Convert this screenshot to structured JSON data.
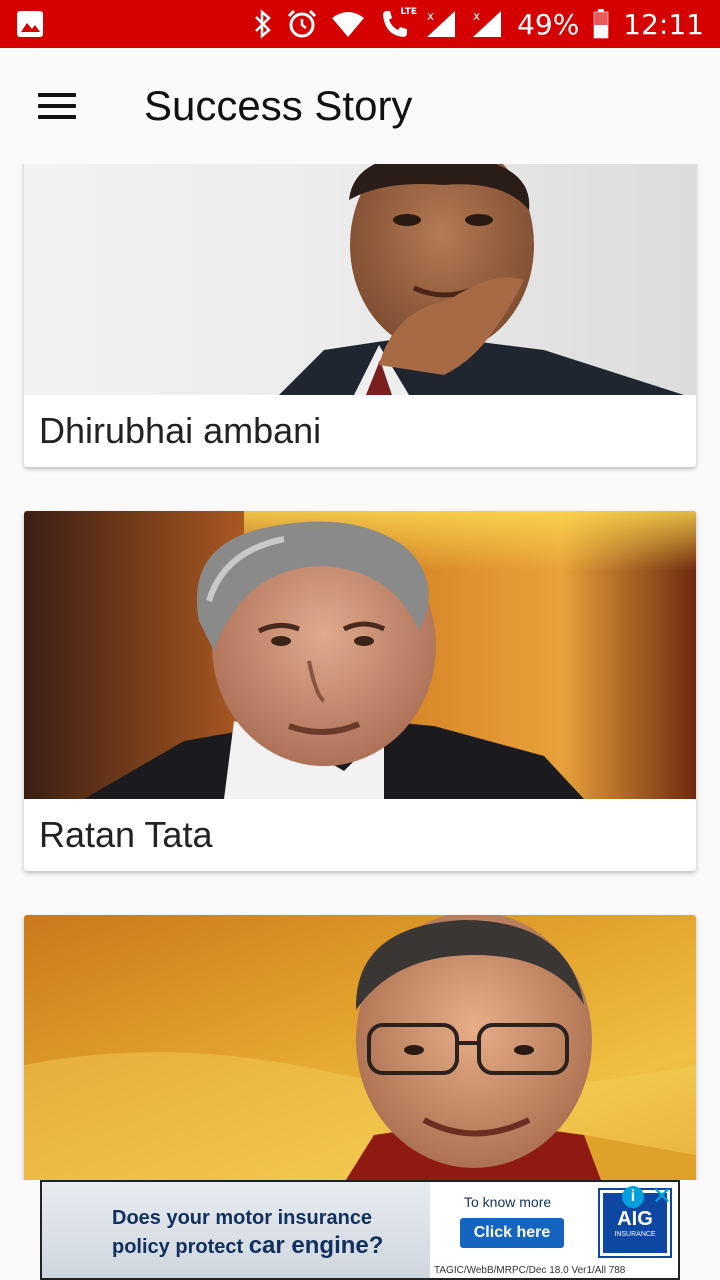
{
  "status_bar": {
    "battery": "49%",
    "time": "12:11",
    "network_label": "LTE"
  },
  "appbar": {
    "title": "Success Story",
    "menu_icon": "hamburger-menu-icon"
  },
  "cards": [
    {
      "name": "Dhirubhai ambani"
    },
    {
      "name": "Ratan Tata"
    },
    {
      "name": ""
    }
  ],
  "ad": {
    "line1": "Does your motor insurance",
    "line2_pre": "policy protect ",
    "line2_bold": "car engine?",
    "know_more": "To know more",
    "cta": "Click here",
    "logo_text": "AIG",
    "logo_sub": "INSURANCE",
    "fine_print": "TAGIC/WebB/MRPC/Dec 18.0   Ver1/All 788",
    "info_icon": "i",
    "close_icon": "✕"
  },
  "colors": {
    "status_bar": "#d50000",
    "app_background": "#fafafa",
    "ad_brand": "#0d47a1"
  }
}
